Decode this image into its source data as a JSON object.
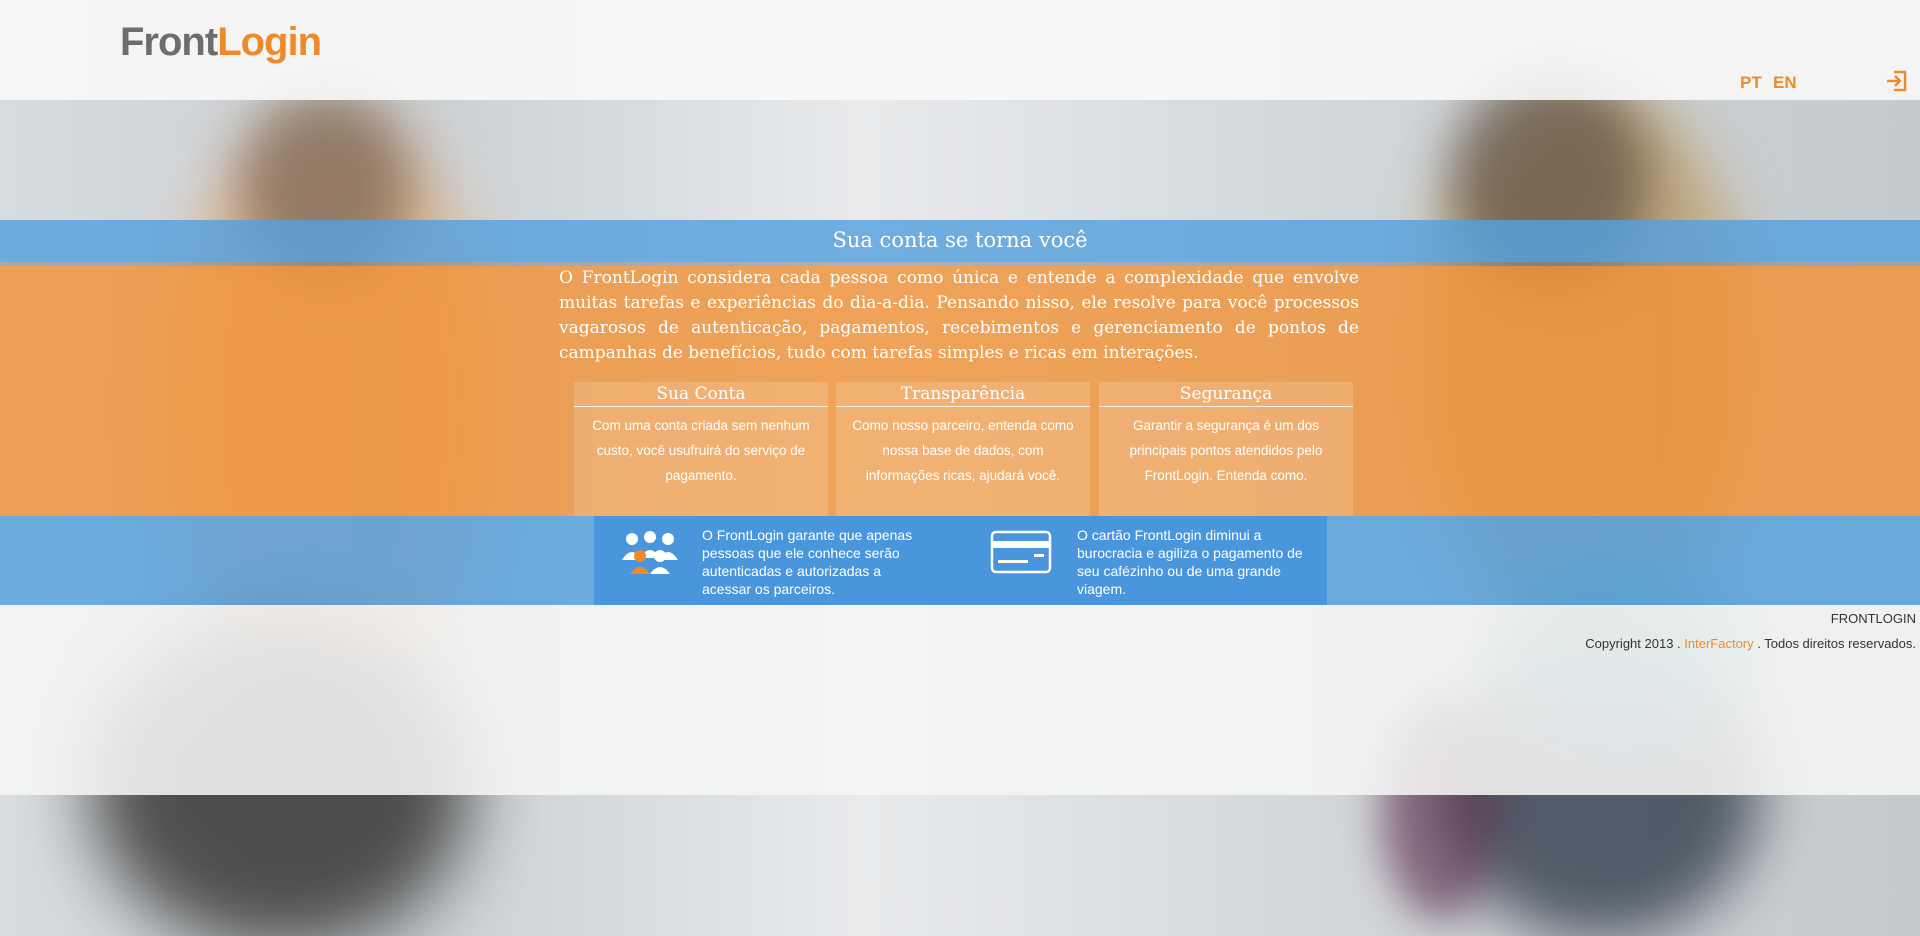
{
  "header": {
    "logo_front": "Front",
    "logo_login": "Login",
    "lang_pt": "PT",
    "lang_en": "EN"
  },
  "hero": {
    "headline": "Sua conta se torna você",
    "intro": "O FrontLogin considera cada pessoa como única e entende a complexidade que envolve muitas tarefas e experiências do dia-a-dia. Pensando nisso, ele resolve para você processos vagarosos de autenticação, pagamentos, recebimentos e gerenciamento de pontos de campanhas de benefícios, tudo com tarefas simples e ricas em interações."
  },
  "columns": [
    {
      "title": "Sua Conta",
      "text": "Com uma conta criada sem nenhum custo, você usufruirá do serviço de pagamento."
    },
    {
      "title": "Transparência",
      "text": "Como nosso parceiro, entenda como nossa base de dados, com informações ricas, ajudará você."
    },
    {
      "title": "Segurança",
      "text": "Garantir a segurança é um dos principais pontos atendidos pelo FrontLogin. Entenda como."
    }
  ],
  "features": [
    {
      "icon": "people-group-icon",
      "text": "O FrontLogin garante que apenas pessoas que ele conhece serão autenticadas e autorizadas a acessar os parceiros."
    },
    {
      "icon": "credit-card-icon",
      "text": "O cartão FrontLogin diminui a burocracia e agiliza o pagamento de seu cafézinho ou de uma grande viagem."
    }
  ],
  "footer": {
    "brand": "FRONTLOGIN",
    "copy_prefix": "Copyright 2013 .",
    "link": "InterFactory",
    "copy_suffix": ". Todos direitos reservados."
  },
  "colors": {
    "accent_orange": "#ef8a2a",
    "band_blue": "#56a0dd",
    "band_orange": "#f09238",
    "logo_gray": "#6d6d6d"
  }
}
